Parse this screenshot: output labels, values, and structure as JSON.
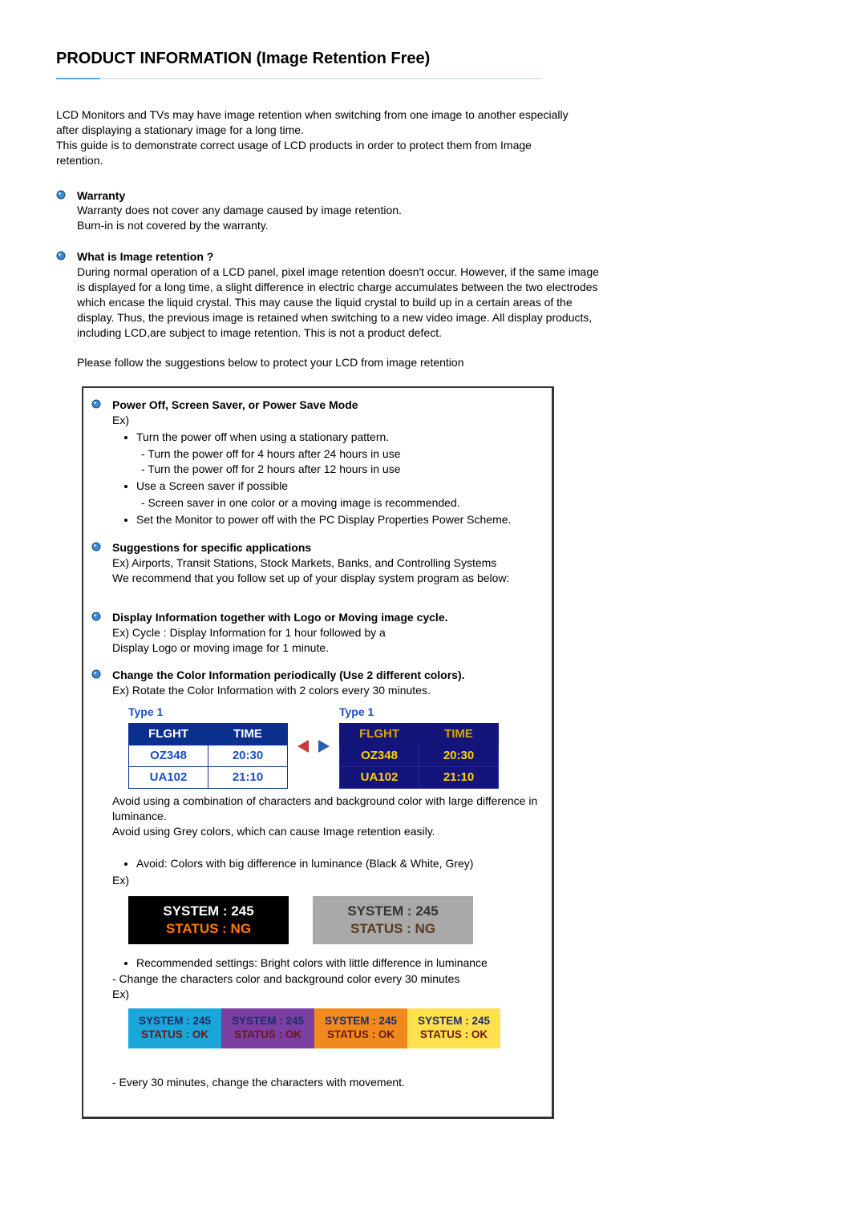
{
  "title": "PRODUCT INFORMATION (Image Retention Free)",
  "intro": {
    "p1": "LCD Monitors and TVs may have image retention when switching from one image to another especially after displaying a stationary image for a long time.",
    "p2": "This guide is to demonstrate correct usage of LCD products in order to protect them from Image retention."
  },
  "warranty": {
    "title": "Warranty",
    "l1": "Warranty does not cover any damage caused by image retention.",
    "l2": "Burn-in is not covered by the warranty."
  },
  "whatIs": {
    "title": "What is Image retention ?",
    "body": "During normal operation of a LCD panel, pixel image retention doesn't occur. However, if the same image is displayed for a long time, a slight difference in electric charge accumulates between the two electrodes which encase the liquid crystal. This may cause the liquid crystal to build up in a certain areas of the display. Thus, the previous image is retained when switching to a new video image. All display products, including LCD,are subject to image retention. This is not a product defect.",
    "follow": "Please follow the suggestions below to protect your LCD from image retention"
  },
  "box": {
    "s1": {
      "title": "Power Off, Screen Saver, or Power Save Mode",
      "ex": "Ex)",
      "b1": "Turn the power off when using a stationary pattern.",
      "b1a": "- Turn the power off for 4 hours after 24 hours in use",
      "b1b": "- Turn the power off for 2 hours after 12 hours in use",
      "b2": "Use a Screen saver if possible",
      "b2a": "- Screen saver in one color or a moving image is recommended.",
      "b3": "Set the Monitor to power off with the PC Display Properties Power Scheme."
    },
    "s2": {
      "title": "Suggestions for specific applications",
      "l1": "Ex) Airports, Transit Stations, Stock Markets, Banks, and Controlling Systems",
      "l2": "We recommend that you follow set up of your display system program as below:"
    },
    "s3": {
      "title": "Display Information together with Logo or Moving image cycle.",
      "l1": "Ex) Cycle : Display Information for 1 hour followed by a",
      "l2": "Display Logo or moving image for 1 minute."
    },
    "s4": {
      "title": "Change the Color Information periodically (Use 2 different colors).",
      "l1": "Ex) Rotate the Color Information with 2 colors every 30 minutes.",
      "flight": {
        "type1": "Type 1",
        "h1": "FLGHT",
        "h2": "TIME",
        "rows": [
          {
            "f": "OZ348",
            "t": "20:30"
          },
          {
            "f": "UA102",
            "t": "21:10"
          }
        ]
      },
      "avoid1": "Avoid using a combination of characters and background color with large difference in luminance.",
      "avoid2": "Avoid using Grey colors, which can cause Image retention easily.",
      "avoidBullet": "Avoid: Colors with big difference in luminance (Black & White, Grey)",
      "ex": "Ex)",
      "sys": {
        "l1": "SYSTEM : 245",
        "l2": "STATUS : NG"
      },
      "recBullet": "Recommended settings: Bright colors with little difference in luminance",
      "recLine": "- Change the characters color and background color every 30 minutes",
      "quad": {
        "l1": "SYSTEM : 245",
        "l2": "STATUS : OK"
      },
      "last": "- Every 30 minutes, change the characters with movement."
    }
  }
}
